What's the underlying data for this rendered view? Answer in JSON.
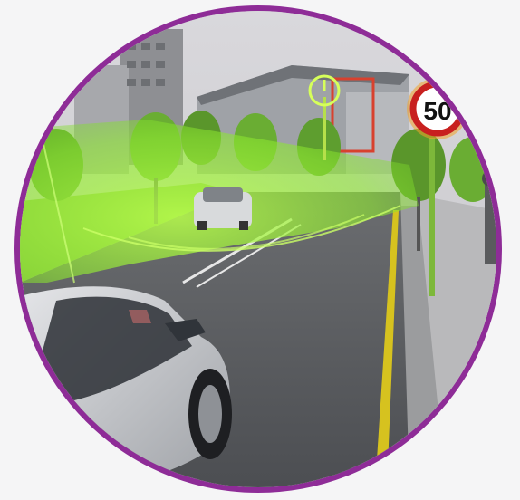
{
  "scene": {
    "speed_limit_sign": {
      "value": "50"
    },
    "frame_color": "#8e2c97",
    "icons": {
      "detection_zone": "sensor-field-green",
      "sign_marker": "speed-limit-sign",
      "clock_marker": "clock-sign"
    }
  }
}
